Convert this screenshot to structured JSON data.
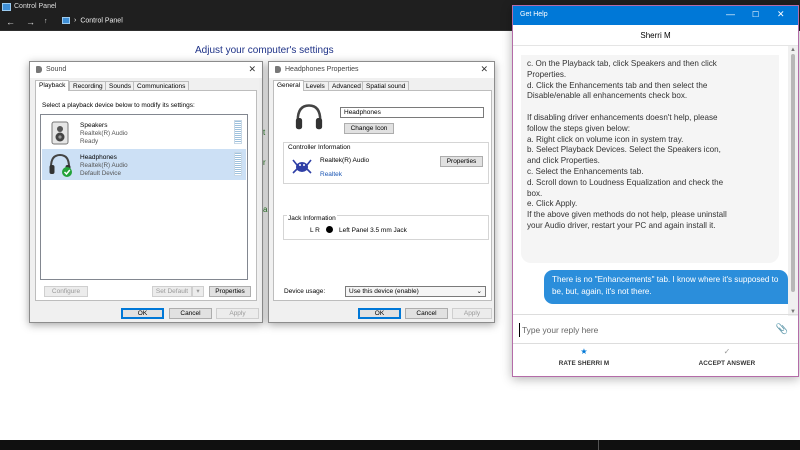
{
  "control_panel": {
    "window_title": "Control Panel",
    "address": "Control Panel",
    "heading": "Adjust your computer's settings"
  },
  "sound": {
    "title": "Sound",
    "tabs": [
      "Playback",
      "Recording",
      "Sounds",
      "Communications"
    ],
    "instruction": "Select a playback device below to modify its settings:",
    "devices": [
      {
        "name": "Speakers",
        "driver": "Realtek(R) Audio",
        "status": "Ready",
        "selected": false
      },
      {
        "name": "Headphones",
        "driver": "Realtek(R) Audio",
        "status": "Default Device",
        "selected": true
      }
    ],
    "configure_label": "Configure",
    "set_default_label": "Set Default",
    "properties_label": "Properties",
    "ok_label": "OK",
    "cancel_label": "Cancel",
    "apply_label": "Apply"
  },
  "headphones_props": {
    "title": "Headphones Properties",
    "tabs": [
      "General",
      "Levels",
      "Advanced",
      "Spatial sound"
    ],
    "device_name": "Headphones",
    "change_icon_label": "Change Icon",
    "controller_heading": "Controller Information",
    "controller_name": "Realtek(R) Audio",
    "controller_link": "Realtek",
    "properties_label": "Properties",
    "jack_heading": "Jack Information",
    "jack_lr": "L R",
    "jack_desc": "Left Panel 3.5 mm Jack",
    "device_usage_label": "Device usage:",
    "device_usage_value": "Use this device (enable)",
    "ok_label": "OK",
    "cancel_label": "Cancel",
    "apply_label": "Apply"
  },
  "get_help": {
    "title": "Get Help",
    "agent": "Sherri M",
    "bot_lines": [
      "c. On the Playback tab, click Speakers and then click",
      "Properties.",
      "d. Click the Enhancements tab and then select the",
      "Disable/enable all enhancements check box.",
      "",
      "If disabling driver enhancements doesn't help, please",
      "follow the steps given below:",
      "a. Right click on volume icon in system tray.",
      "b. Select Playback Devices. Select the Speakers icon,",
      "and click Properties.",
      "c. Select the Enhancements tab.",
      "d. Scroll down to Loudness Equalization and check the",
      "box.",
      "e. Click Apply.",
      "If the above given methods do not help, please uninstall",
      "your Audio driver, restart your PC and again install it."
    ],
    "user_message": "There is no \"Enhancements\" tab. I know where it's supposed to be, but, again, it's not there.",
    "reply_placeholder": "Type your reply here",
    "rate_label": "RATE SHERRI M",
    "accept_label": "ACCEPT ANSWER",
    "accent_color": "#0078d7"
  }
}
